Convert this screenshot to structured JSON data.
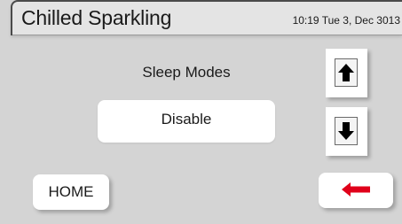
{
  "header": {
    "title": "Chilled Sparkling",
    "clock": "10:19 Tue 3, Dec 3013"
  },
  "settings": {
    "label": "Sleep Modes",
    "value": "Disable"
  },
  "controls": {
    "up_icon": "arrow-up-icon",
    "down_icon": "arrow-down-icon",
    "home_label": "HOME",
    "back_icon": "arrow-left-icon",
    "back_color": "#e0001a"
  }
}
